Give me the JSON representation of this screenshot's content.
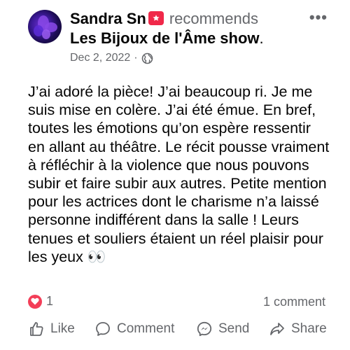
{
  "post": {
    "author_name": "Sandra Sn",
    "action_text": "recommends",
    "page_name": "Les Bijoux de l'Âme show",
    "page_suffix": ".",
    "date": "Dec 2, 2022",
    "date_separator": "·",
    "privacy_icon": "globe-icon",
    "more_label": "•••",
    "body": "J’ai adoré la pièce! J’ai beaucoup ri. Je me suis mise en colère. J’ai été émue. En bref, toutes les émotions qu’on espère ressentir en allant au théâtre. Le récit pousse vraiment à réfléchir à la violence que nous pouvons subir et faire subir aux autres. Petite mention pour les actrices dont le charisme n’a laissé personne indifférent dans la salle ! Leurs tenues et souliers étaient un réel plaisir pour les yeux 👀"
  },
  "stats": {
    "reaction_count": "1",
    "comment_count": "1 comment"
  },
  "actions": {
    "like": "Like",
    "comment": "Comment",
    "send": "Send",
    "share": "Share"
  },
  "colors": {
    "text": "#050505",
    "secondary": "#65676b",
    "recommend_badge": "#f02849",
    "heart": "#f33e58"
  }
}
